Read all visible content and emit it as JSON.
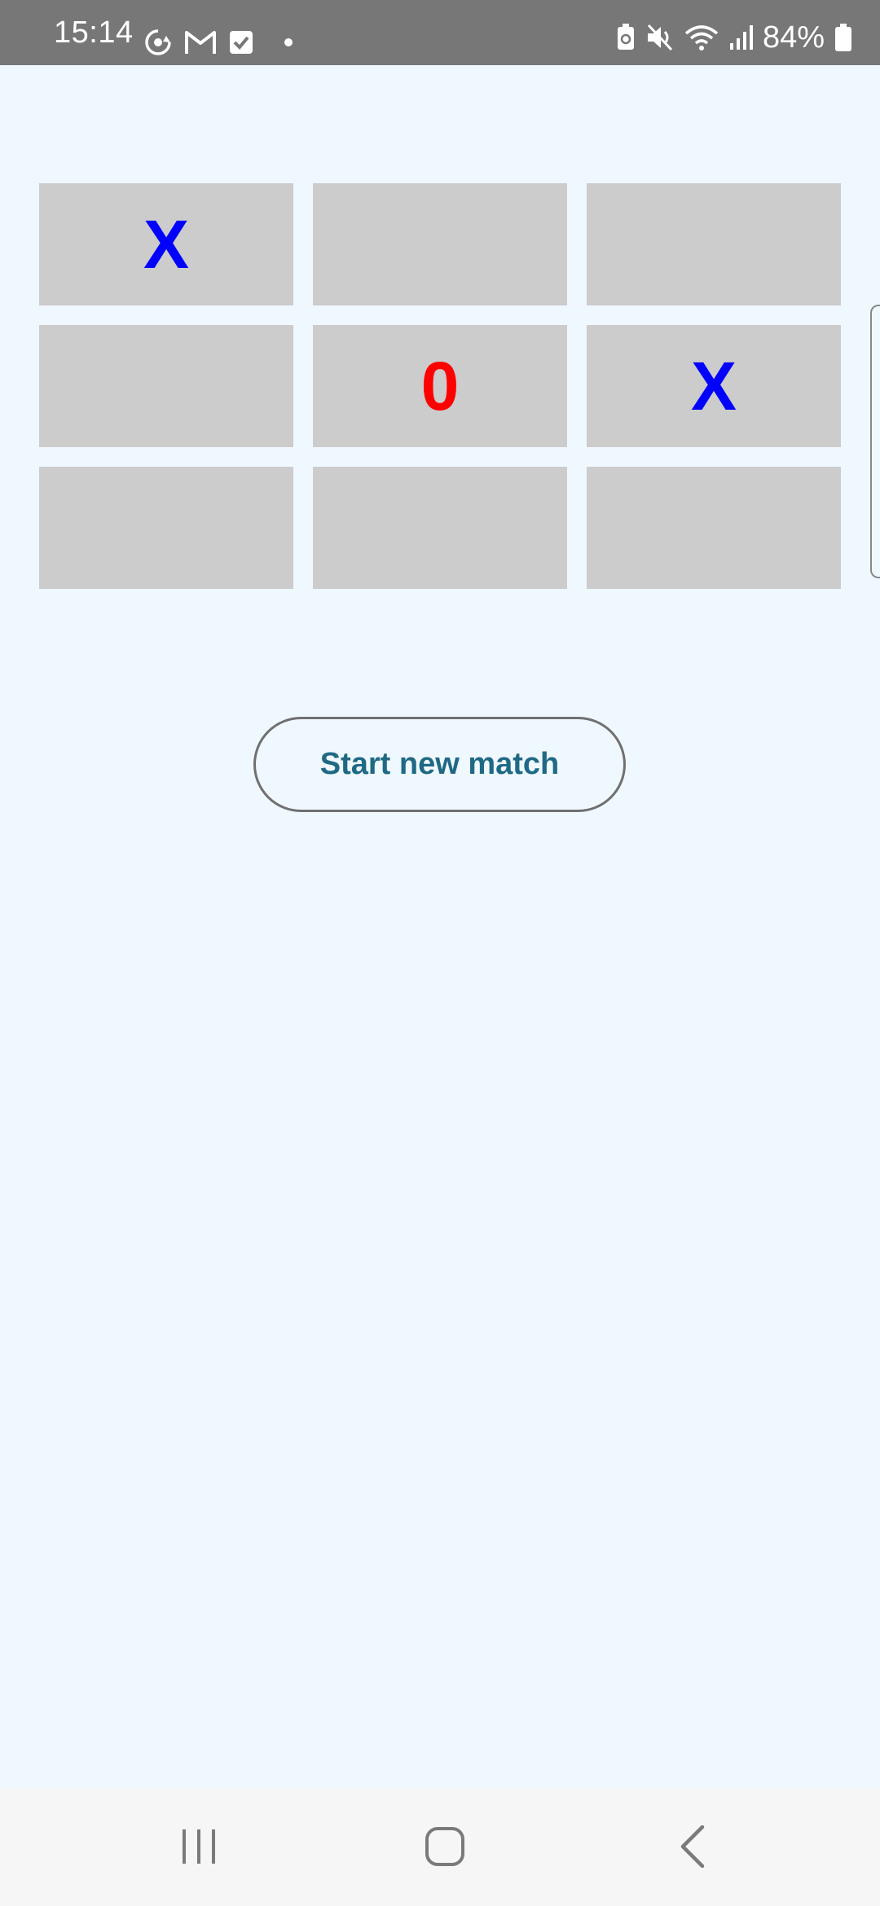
{
  "status_bar": {
    "time": "15:14",
    "battery_percent": "84%",
    "icons": [
      "sync-icon",
      "gmail-icon",
      "checkbox-icon",
      "dot-icon",
      "battery-saver-icon",
      "mute-icon",
      "wifi-icon",
      "signal-icon",
      "battery-icon"
    ]
  },
  "board": {
    "cells": [
      {
        "mark": "X",
        "player": "x"
      },
      {
        "mark": "",
        "player": ""
      },
      {
        "mark": "",
        "player": ""
      },
      {
        "mark": "",
        "player": ""
      },
      {
        "mark": "0",
        "player": "o"
      },
      {
        "mark": "X",
        "player": "x"
      },
      {
        "mark": "",
        "player": ""
      },
      {
        "mark": "",
        "player": ""
      },
      {
        "mark": "",
        "player": ""
      }
    ],
    "colors": {
      "x": "#0000FF",
      "o": "#FF0000",
      "cell": "#CCCCCC",
      "background": "#F0F8FF"
    }
  },
  "actions": {
    "start_new_match_label": "Start new match",
    "button_text_color": "#1F6985"
  },
  "nav_bar": {
    "icons": [
      "recent-apps-icon",
      "home-icon",
      "back-icon"
    ]
  }
}
